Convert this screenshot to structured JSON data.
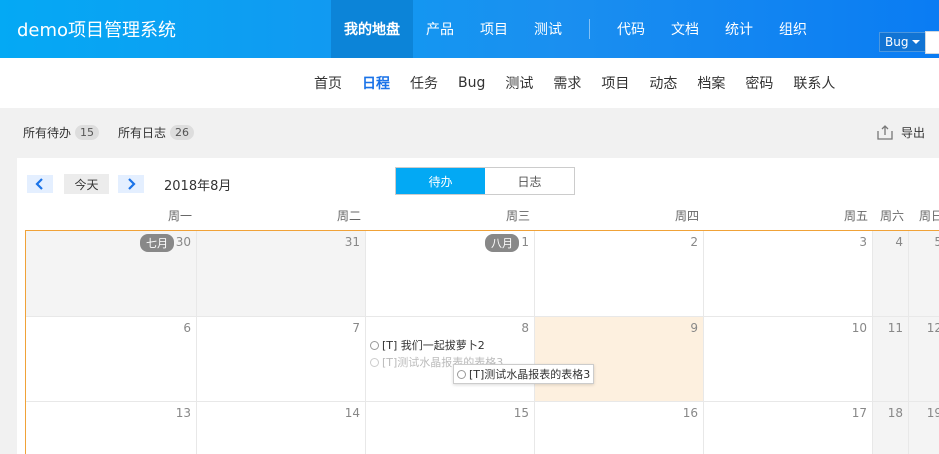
{
  "app": {
    "brand": "demo项目管理系统"
  },
  "main_nav": {
    "items": [
      "我的地盘",
      "产品",
      "项目",
      "测试",
      "代码",
      "文档",
      "统计",
      "组织"
    ],
    "active_index": 0,
    "bug_select": "Bug"
  },
  "sub_nav": {
    "items": [
      "首页",
      "日程",
      "任务",
      "Bug",
      "测试",
      "需求",
      "项目",
      "动态",
      "档案",
      "密码",
      "联系人"
    ],
    "active_index": 1
  },
  "toolbar": {
    "todo_label": "所有待办",
    "todo_count": "15",
    "log_label": "所有日志",
    "log_count": "26",
    "export_label": "导出"
  },
  "calendar": {
    "prev_icon": "chevron-left-icon",
    "next_icon": "chevron-right-icon",
    "today_label": "今天",
    "month_title": "2018年8月",
    "tabs": [
      "待办",
      "日志"
    ],
    "active_tab": 0,
    "weekdays": [
      "周一",
      "周二",
      "周三",
      "周四",
      "周五",
      "周六",
      "周日"
    ],
    "rows": [
      [
        {
          "day": "30",
          "tag": "七月",
          "other": true
        },
        {
          "day": "31",
          "other": true
        },
        {
          "day": "1",
          "tag": "八月"
        },
        {
          "day": "2"
        },
        {
          "day": "3"
        },
        {
          "day": "4",
          "weekend": true
        },
        {
          "day": "5",
          "weekend": true
        }
      ],
      [
        {
          "day": "6"
        },
        {
          "day": "7"
        },
        {
          "day": "8"
        },
        {
          "day": "9",
          "highlight": true
        },
        {
          "day": "10"
        },
        {
          "day": "11",
          "weekend": true
        },
        {
          "day": "12",
          "weekend": true
        }
      ],
      [
        {
          "day": "13"
        },
        {
          "day": "14"
        },
        {
          "day": "15"
        },
        {
          "day": "16"
        },
        {
          "day": "17"
        },
        {
          "day": "18",
          "weekend": true
        },
        {
          "day": "19",
          "weekend": true
        }
      ]
    ],
    "events": {
      "e1": "[T] 我们一起拔萝卜2",
      "e2": "[T]测试水晶报表的表格3",
      "e_drag": "[T]测试水晶报表的表格3"
    }
  },
  "colors": {
    "header_start": "#04a9f4",
    "header_end": "#0a7cf3",
    "active_tab": "#03a9f4",
    "grid_border": "#f0a238",
    "highlight_cell": "#fdf0df"
  }
}
